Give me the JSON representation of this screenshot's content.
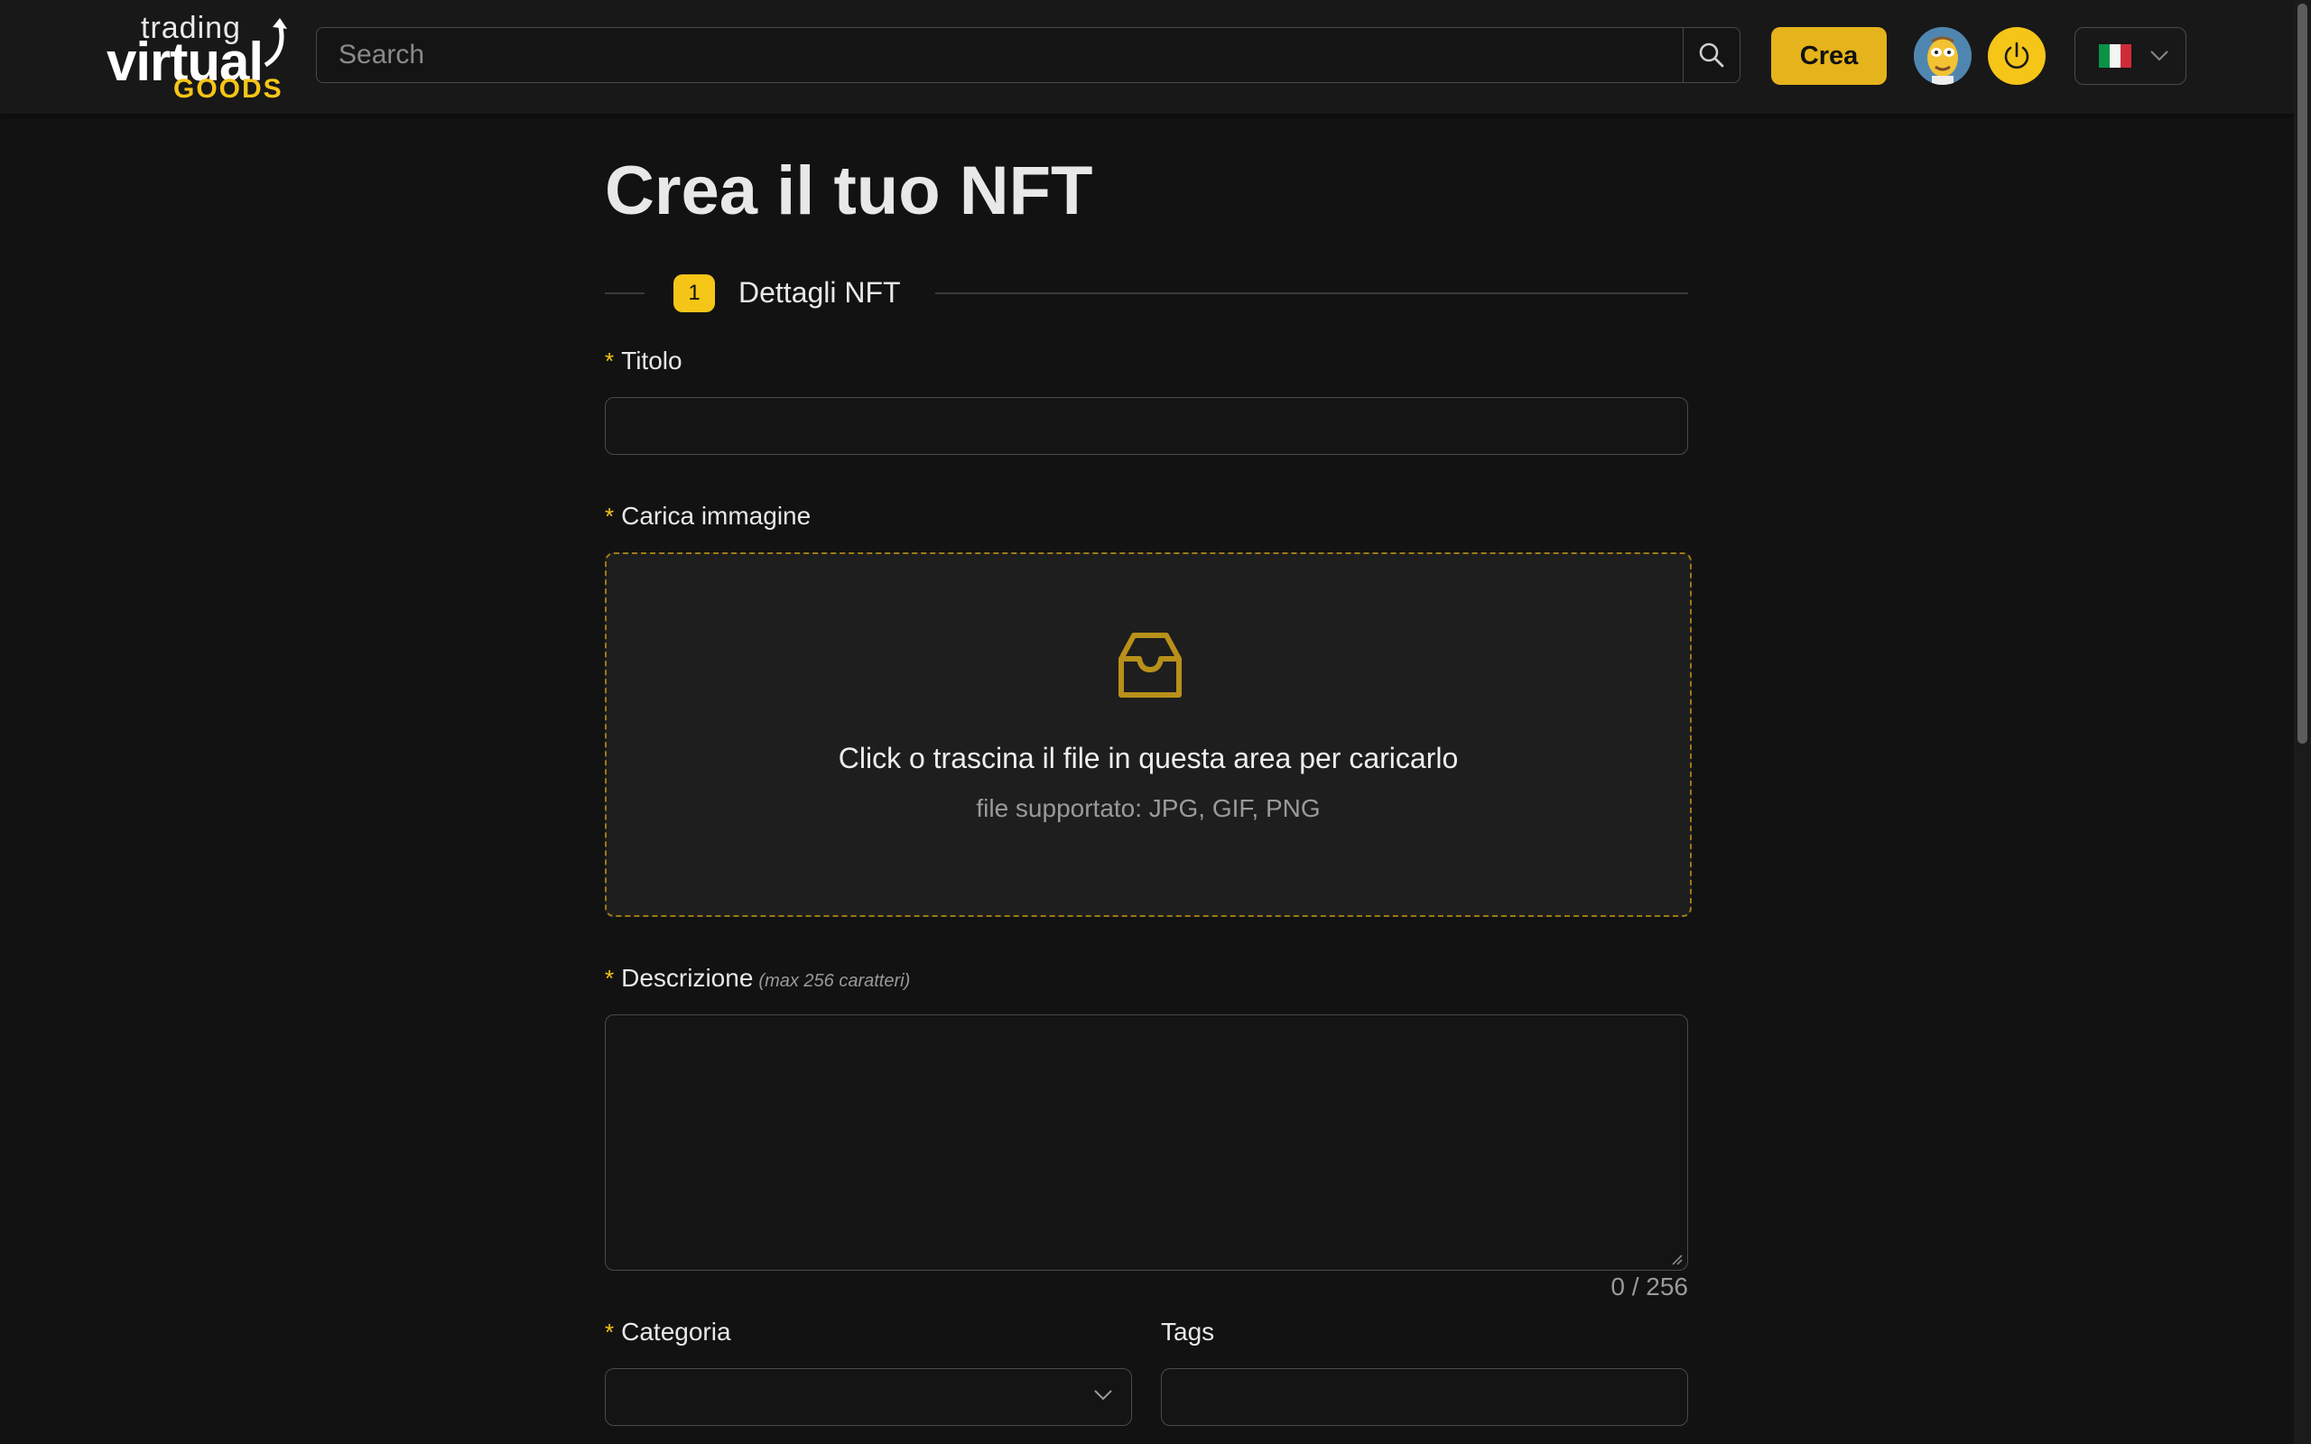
{
  "header": {
    "logo": {
      "line1": "trading",
      "line2": "virtual",
      "line3": "GOODS"
    },
    "search": {
      "placeholder": "Search",
      "value": ""
    },
    "search_button_icon": "search-icon",
    "create_button": "Crea",
    "power_icon": "power-icon",
    "language_flag": "italy-flag-icon",
    "language_chevron": "chevron-down-icon"
  },
  "main": {
    "title": "Crea il tuo NFT",
    "step": {
      "number": "1",
      "label": "Dettagli NFT"
    },
    "form": {
      "title_field": {
        "label": "Titolo",
        "required_mark": "*",
        "value": ""
      },
      "image_upload": {
        "label": "Carica immagine",
        "required_mark": "*",
        "icon": "inbox-icon",
        "instruction": "Click o trascina il file in questa area per caricarlo",
        "hint": "file supportato: JPG, GIF, PNG"
      },
      "description": {
        "label": "Descrizione",
        "required_mark": "*",
        "hint": "(max 256 caratteri)",
        "value": "",
        "counter": "0 / 256"
      },
      "category": {
        "label": "Categoria",
        "required_mark": "*",
        "value": ""
      },
      "tags": {
        "label": "Tags",
        "value": ""
      }
    }
  },
  "colors": {
    "accent": "#f5c518",
    "button": "#e5b31b",
    "background": "#121212",
    "header_bg": "#181818",
    "dashed_border": "#9c7a14"
  }
}
